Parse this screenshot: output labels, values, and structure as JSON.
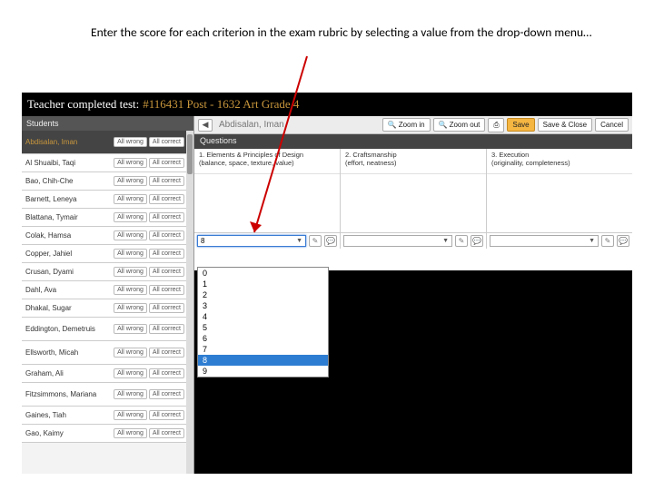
{
  "instruction": "Enter the score for each criterion in the exam rubric by selecting a value from the drop-down menu…",
  "title": {
    "prefix": "Teacher completed test:",
    "suffix": "#116431 Post - 1632 Art Grade 4"
  },
  "sidebar": {
    "header": "Students",
    "btn_wrong": "All wrong",
    "btn_correct": "All correct",
    "items": [
      {
        "name": "Abdisalan, Iman",
        "sel": true
      },
      {
        "name": "Al Shuaibi, Taqi"
      },
      {
        "name": "Bao, Chih-Che"
      },
      {
        "name": "Barnett, Leneya"
      },
      {
        "name": "Blattana, Tymair"
      },
      {
        "name": "Colak, Hamsa"
      },
      {
        "name": "Copper, Jahiel"
      },
      {
        "name": "Crusan, Dyami"
      },
      {
        "name": "Dahl, Ava"
      },
      {
        "name": "Dhakal, Sugar"
      },
      {
        "name": "Eddington, Demetruis"
      },
      {
        "name": "Ellsworth, Micah"
      },
      {
        "name": "Graham, Ali"
      },
      {
        "name": "Fitzsimmons, Mariana"
      },
      {
        "name": "Gaines, Tiah"
      },
      {
        "name": "Gao, Kaimy"
      }
    ]
  },
  "toolbar": {
    "student": "Abdisalan, Iman",
    "zoom_in": "Zoom in",
    "zoom_out": "Zoom out",
    "save": "Save",
    "save_close": "Save & Close",
    "cancel": "Cancel"
  },
  "questions": {
    "header": "Questions",
    "cols": [
      {
        "num": "1.",
        "title": "Elements & Principles of Design",
        "sub": "(balance, space, texture, value)"
      },
      {
        "num": "2.",
        "title": "Craftsmanship",
        "sub": "(effort, neatness)"
      },
      {
        "num": "3.",
        "title": "Execution",
        "sub": "(originality, completeness)"
      }
    ],
    "selected": "8"
  },
  "dropdown": {
    "options": [
      "0",
      "1",
      "2",
      "3",
      "4",
      "5",
      "6",
      "7",
      "8",
      "9"
    ],
    "highlight": "8"
  }
}
